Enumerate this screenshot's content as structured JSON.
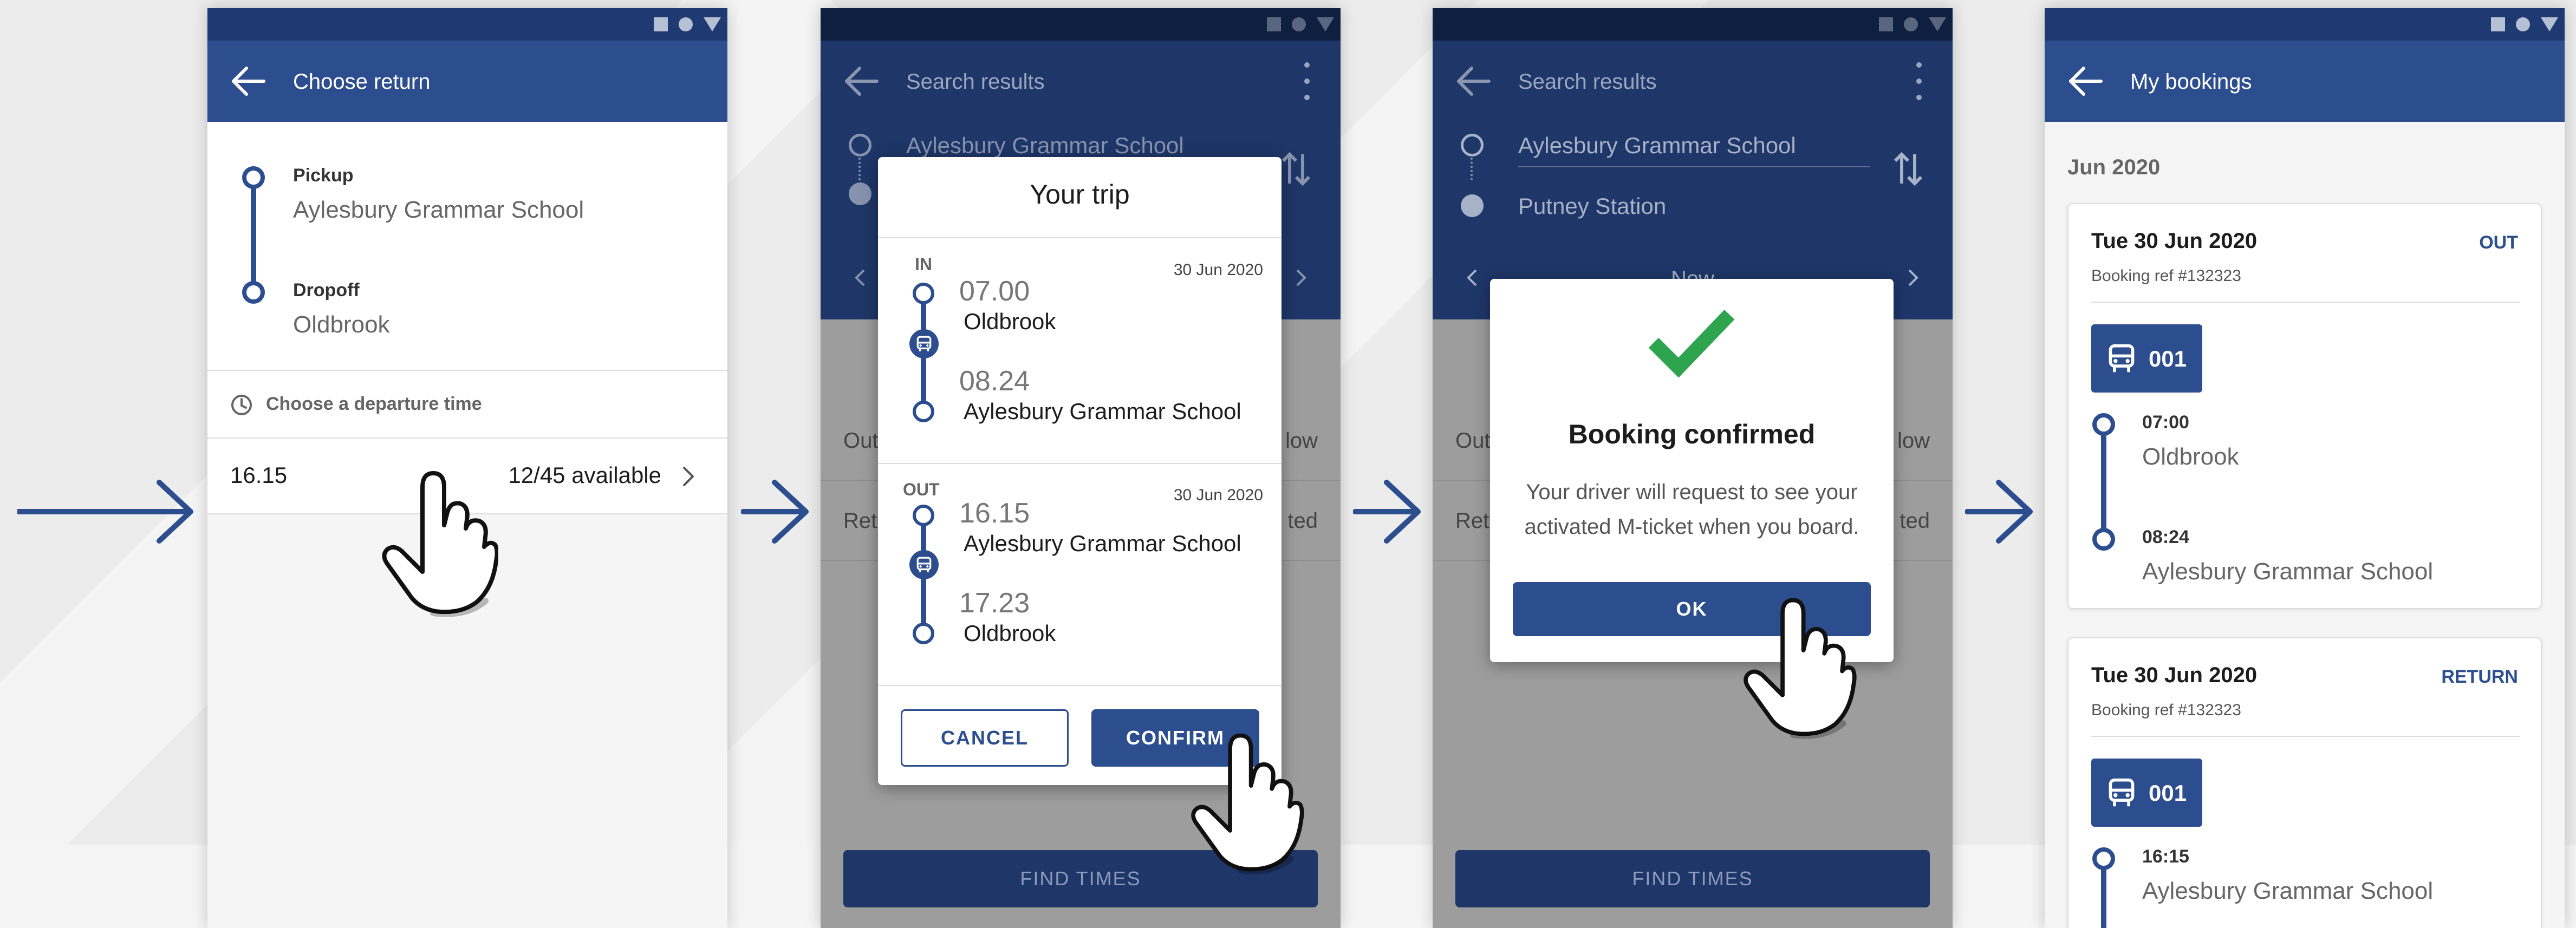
{
  "screens": [
    {
      "title": "Choose return",
      "pickup_label": "Pickup",
      "pickup_value": "Aylesbury Grammar School",
      "dropoff_label": "Dropoff",
      "dropoff_value": "Oldbrook",
      "prompt": "Choose a departure time",
      "option_time": "16.15",
      "option_availability": "12/45 available"
    },
    {
      "header_title": "Search results",
      "from": "Aylesbury Grammar School",
      "row_out_left": "Out",
      "row_out_right": "low",
      "row_ret_left": "Ret",
      "row_ret_right": "ted",
      "find_times": "FIND TIMES",
      "dialog": {
        "title": "Your trip",
        "in": {
          "tag": "IN",
          "date": "30 Jun 2020",
          "dep_time": "07.00",
          "dep_stop": "Oldbrook",
          "arr_time": "08.24",
          "arr_stop": "Aylesbury Grammar School"
        },
        "out": {
          "tag": "OUT",
          "date": "30 Jun 2020",
          "dep_time": "16.15",
          "dep_stop": "Aylesbury Grammar School",
          "arr_time": "17.23",
          "arr_stop": "Oldbrook"
        },
        "cancel": "CANCEL",
        "confirm": "CONFIRM"
      }
    },
    {
      "header_title": "Search results",
      "from": "Aylesbury Grammar School",
      "to": "Putney Station",
      "date_label": "Now",
      "row_out_left": "Out",
      "row_out_right": "low",
      "row_ret_left": "Ret",
      "row_ret_right": "ted",
      "find_times": "FIND TIMES",
      "dialog": {
        "title": "Booking confirmed",
        "message_line1": "Your driver will request to see your",
        "message_line2": "activated M-ticket when you board.",
        "ok": "OK"
      }
    },
    {
      "title": "My bookings",
      "month": "Jun 2020",
      "bookings": [
        {
          "date": "Tue 30 Jun 2020",
          "direction": "OUT",
          "ref": "Booking ref #132323",
          "route": "001",
          "stops": [
            {
              "time": "07:00",
              "name": "Oldbrook"
            },
            {
              "time": "08:24",
              "name": "Aylesbury Grammar School"
            }
          ]
        },
        {
          "date": "Tue 30 Jun 2020",
          "direction": "RETURN",
          "ref": "Booking ref #132323",
          "route": "001",
          "stops": [
            {
              "time": "16:15",
              "name": "Aylesbury Grammar School"
            }
          ]
        }
      ]
    }
  ],
  "colors": {
    "primary": "#2c4e8f",
    "primary_dark": "#1e3668",
    "status_bar": "#1f3a72",
    "success": "#2ea44f",
    "background": "#ececec"
  }
}
